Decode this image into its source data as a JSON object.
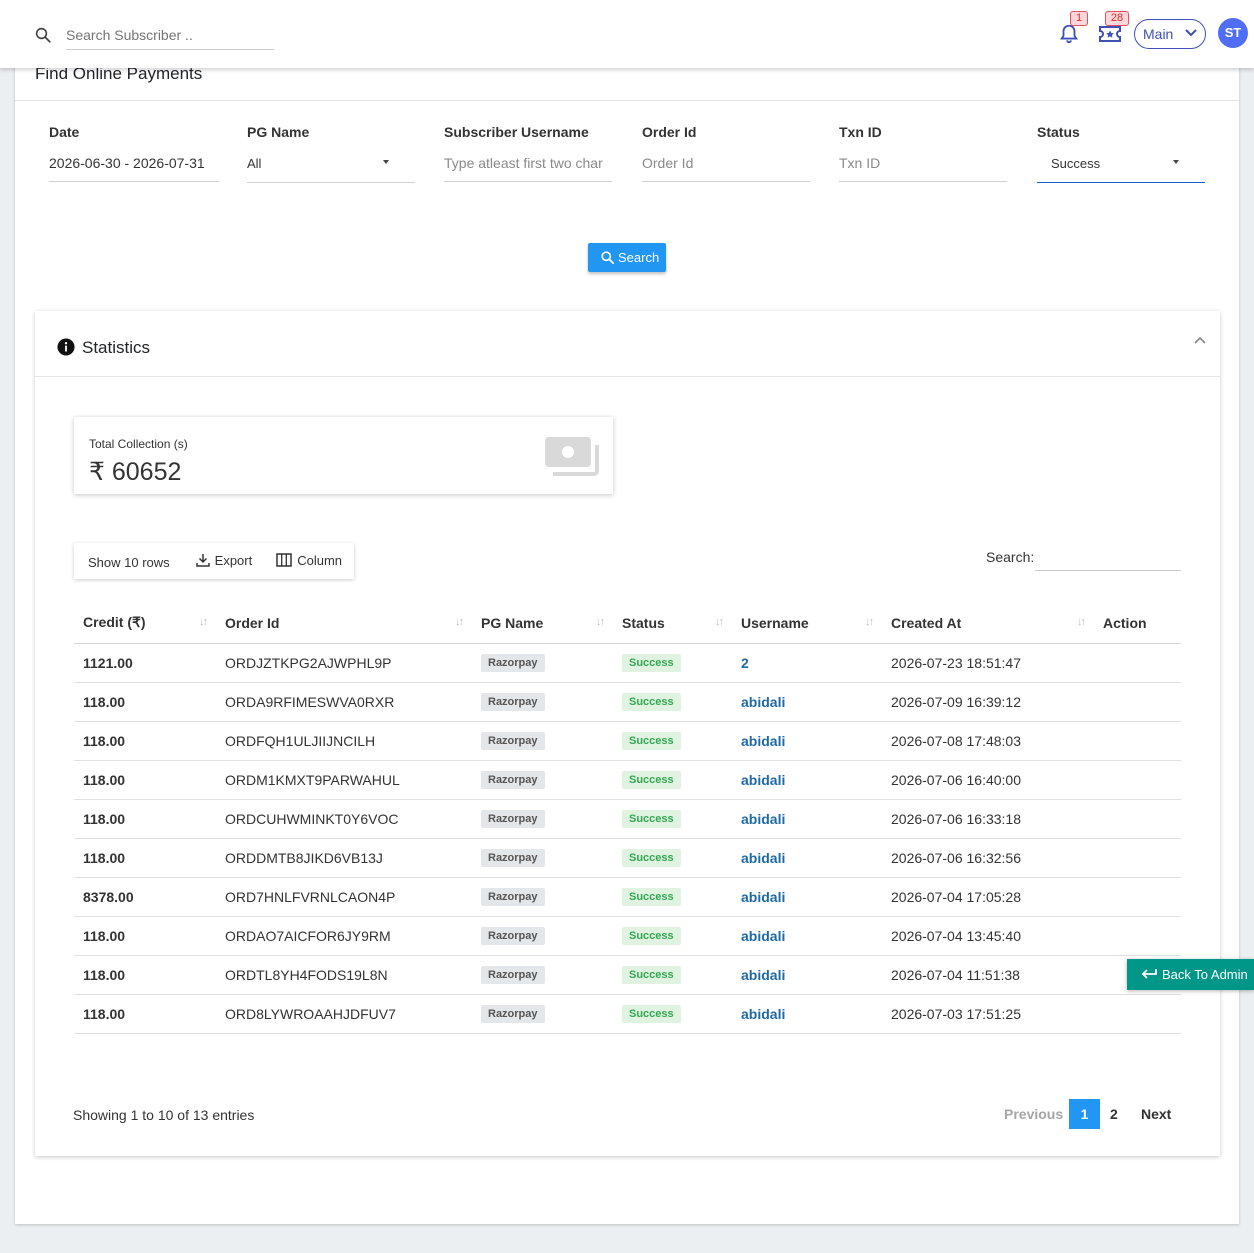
{
  "topbar": {
    "search_placeholder": "Search Subscriber ..",
    "notifications_count": "1",
    "tickets_count": "28",
    "workspace": "Main",
    "avatar_initials": "ST"
  },
  "page": {
    "title": "Find Online Payments"
  },
  "filters": {
    "date": {
      "label": "Date",
      "value": "2026-06-30 - 2026-07-31"
    },
    "pg_name": {
      "label": "PG Name",
      "value": "All"
    },
    "username": {
      "label": "Subscriber Username",
      "placeholder": "Type atleast first two char"
    },
    "order_id": {
      "label": "Order Id",
      "placeholder": "Order Id"
    },
    "txn_id": {
      "label": "Txn ID",
      "placeholder": "Txn ID"
    },
    "status": {
      "label": "Status",
      "value": "Success"
    },
    "search_button": "Search"
  },
  "statistics": {
    "title": "Statistics",
    "total_label": "Total Collection (s)",
    "total_value": "₹ 60652"
  },
  "table_controls": {
    "show_rows": "Show 10 rows",
    "export": "Export",
    "column": "Column",
    "search_label": "Search:"
  },
  "table": {
    "columns": [
      "Credit (₹)",
      "Order Id",
      "PG Name",
      "Status",
      "Username",
      "Created At",
      "Action"
    ],
    "rows": [
      {
        "credit": "1121.00",
        "order_id": "ORDJZTKPG2AJWPHL9P",
        "pg": "Razorpay",
        "status": "Success",
        "username": "2",
        "created": "2026-07-23 18:51:47"
      },
      {
        "credit": "118.00",
        "order_id": "ORDA9RFIMESWVA0RXR",
        "pg": "Razorpay",
        "status": "Success",
        "username": "abidali",
        "created": "2026-07-09 16:39:12"
      },
      {
        "credit": "118.00",
        "order_id": "ORDFQH1ULJIIJNCILH",
        "pg": "Razorpay",
        "status": "Success",
        "username": "abidali",
        "created": "2026-07-08 17:48:03"
      },
      {
        "credit": "118.00",
        "order_id": "ORDM1KMXT9PARWAHUL",
        "pg": "Razorpay",
        "status": "Success",
        "username": "abidali",
        "created": "2026-07-06 16:40:00"
      },
      {
        "credit": "118.00",
        "order_id": "ORDCUHWMINKT0Y6VOC",
        "pg": "Razorpay",
        "status": "Success",
        "username": "abidali",
        "created": "2026-07-06 16:33:18"
      },
      {
        "credit": "118.00",
        "order_id": "ORDDMTB8JIKD6VB13J",
        "pg": "Razorpay",
        "status": "Success",
        "username": "abidali",
        "created": "2026-07-06 16:32:56"
      },
      {
        "credit": "8378.00",
        "order_id": "ORD7HNLFVRNLCAON4P",
        "pg": "Razorpay",
        "status": "Success",
        "username": "abidali",
        "created": "2026-07-04 17:05:28"
      },
      {
        "credit": "118.00",
        "order_id": "ORDAO7AICFOR6JY9RM",
        "pg": "Razorpay",
        "status": "Success",
        "username": "abidali",
        "created": "2026-07-04 13:45:40"
      },
      {
        "credit": "118.00",
        "order_id": "ORDTL8YH4FODS19L8N",
        "pg": "Razorpay",
        "status": "Success",
        "username": "abidali",
        "created": "2026-07-04 11:51:38"
      },
      {
        "credit": "118.00",
        "order_id": "ORD8LYWROAAHJDFUV7",
        "pg": "Razorpay",
        "status": "Success",
        "username": "abidali",
        "created": "2026-07-03 17:51:25"
      }
    ]
  },
  "footer": {
    "entries_info": "Showing 1 to 10 of 13 entries",
    "previous": "Previous",
    "page_1": "1",
    "page_2": "2",
    "next": "Next"
  },
  "back_to_admin": "Back To Admin",
  "colors": {
    "primary": "#2196f3",
    "accent": "#3f51b5",
    "success": "#34a853",
    "teal": "#009688"
  }
}
